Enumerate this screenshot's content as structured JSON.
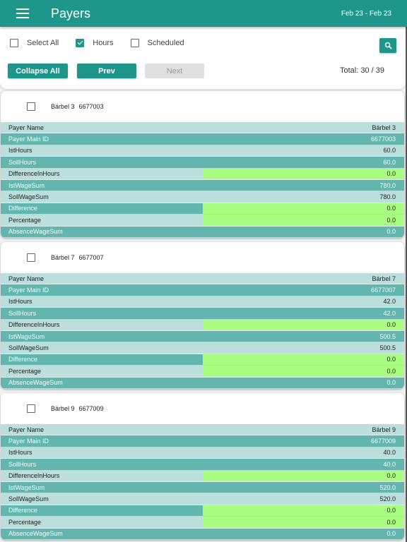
{
  "appbar": {
    "title": "Payers",
    "date_range": "Feb 23 - Feb 23"
  },
  "toolbar": {
    "checkboxes": [
      {
        "label": "Select All",
        "checked": false
      },
      {
        "label": "Hours",
        "checked": true
      },
      {
        "label": "Scheduled",
        "checked": false
      }
    ],
    "collapse_all_label": "Collapse All",
    "prev_label": "Prev",
    "next_label": "Next",
    "total_label": "Total: 30 / 39",
    "search_icon": "search-icon"
  },
  "highlight_color": "#a9fd80",
  "accent_color": "#1f968a",
  "payers": [
    {
      "name": "Bärbel 3",
      "id": "6677003",
      "selected": false,
      "rows": [
        {
          "key": "Payer Name",
          "value": "Bärbel 3"
        },
        {
          "key": "Payer Main ID",
          "value": "6677003"
        },
        {
          "key": "IstHours",
          "value": "60.0"
        },
        {
          "key": "SollHours",
          "value": "60.0"
        },
        {
          "key": "DifferenceInHours",
          "value": "0.0",
          "highlight": true
        },
        {
          "key": "IstWageSum",
          "value": "780.0"
        },
        {
          "key": "SollWageSum",
          "value": "780.0"
        },
        {
          "key": "Difference",
          "value": "0.0",
          "highlight": true
        },
        {
          "key": "Percentage",
          "value": "0.0",
          "highlight": true
        },
        {
          "key": "AbsenceWageSum",
          "value": "0.0"
        }
      ]
    },
    {
      "name": "Bärbel 7",
      "id": "6677007",
      "selected": false,
      "rows": [
        {
          "key": "Payer Name",
          "value": "Bärbel 7"
        },
        {
          "key": "Payer Main ID",
          "value": "6677007"
        },
        {
          "key": "IstHours",
          "value": "42.0"
        },
        {
          "key": "SollHours",
          "value": "42.0"
        },
        {
          "key": "DifferenceInHours",
          "value": "0.0",
          "highlight": true
        },
        {
          "key": "IstWageSum",
          "value": "500.5"
        },
        {
          "key": "SollWageSum",
          "value": "500.5"
        },
        {
          "key": "Difference",
          "value": "0.0",
          "highlight": true
        },
        {
          "key": "Percentage",
          "value": "0.0",
          "highlight": true
        },
        {
          "key": "AbsenceWageSum",
          "value": "0.0"
        }
      ]
    },
    {
      "name": "Bärbel 9",
      "id": "6677009",
      "selected": false,
      "rows": [
        {
          "key": "Payer Name",
          "value": "Bärbel 9"
        },
        {
          "key": "Payer Main ID",
          "value": "6677009"
        },
        {
          "key": "IstHours",
          "value": "40.0"
        },
        {
          "key": "SollHours",
          "value": "40.0"
        },
        {
          "key": "DifferenceInHours",
          "value": "0.0",
          "highlight": true
        },
        {
          "key": "IstWageSum",
          "value": "520.0"
        },
        {
          "key": "SollWageSum",
          "value": "520.0"
        },
        {
          "key": "Difference",
          "value": "0.0",
          "highlight": true
        },
        {
          "key": "Percentage",
          "value": "0.0",
          "highlight": true
        },
        {
          "key": "AbsenceWageSum",
          "value": "0.0"
        }
      ]
    }
  ]
}
